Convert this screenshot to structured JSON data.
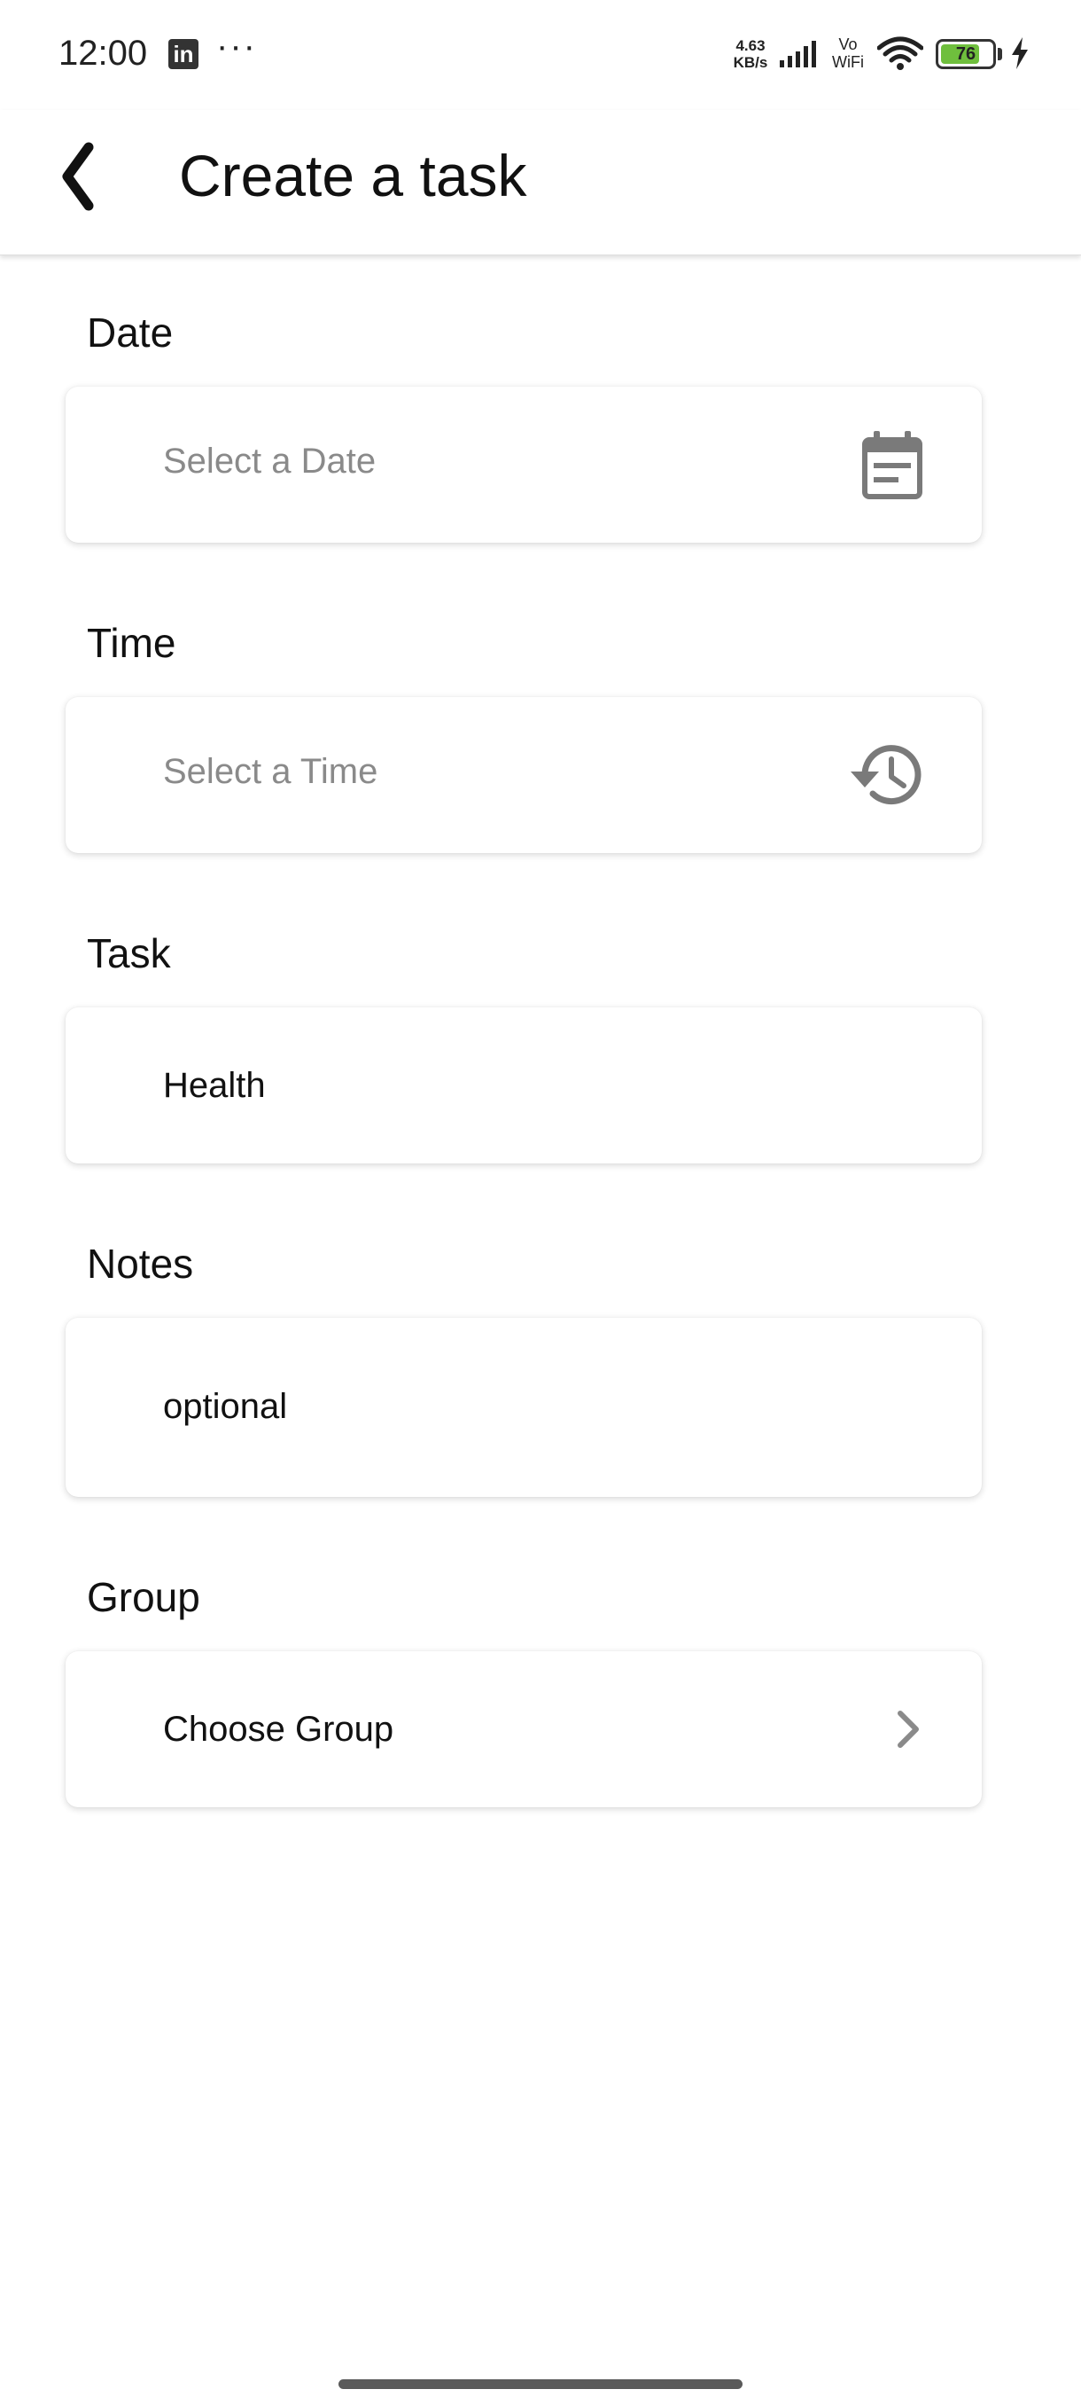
{
  "status_bar": {
    "time": "12:00",
    "linkedin_icon": "in",
    "more_indicator": "···",
    "network_speed_value": "4.63",
    "network_speed_unit": "KB/s",
    "vowifi_top": "Vo",
    "vowifi_bottom": "WiFi",
    "battery_level": "76",
    "battery_fraction": 0.76,
    "battery_color": "#6fbf3d",
    "icons": [
      "linkedin-icon",
      "signal-icon",
      "wifi-icon",
      "battery-icon",
      "charging-icon"
    ]
  },
  "header": {
    "title": "Create a task",
    "back_icon": "chevron-left-icon"
  },
  "form": {
    "date": {
      "label": "Date",
      "placeholder": "Select a Date",
      "icon": "calendar-icon"
    },
    "time": {
      "label": "Time",
      "placeholder": "Select a Time",
      "icon": "history-clock-icon"
    },
    "task": {
      "label": "Task",
      "value": "Health"
    },
    "notes": {
      "label": "Notes",
      "value": "optional"
    },
    "group": {
      "label": "Group",
      "value": "Choose Group",
      "icon": "chevron-right-icon"
    }
  }
}
